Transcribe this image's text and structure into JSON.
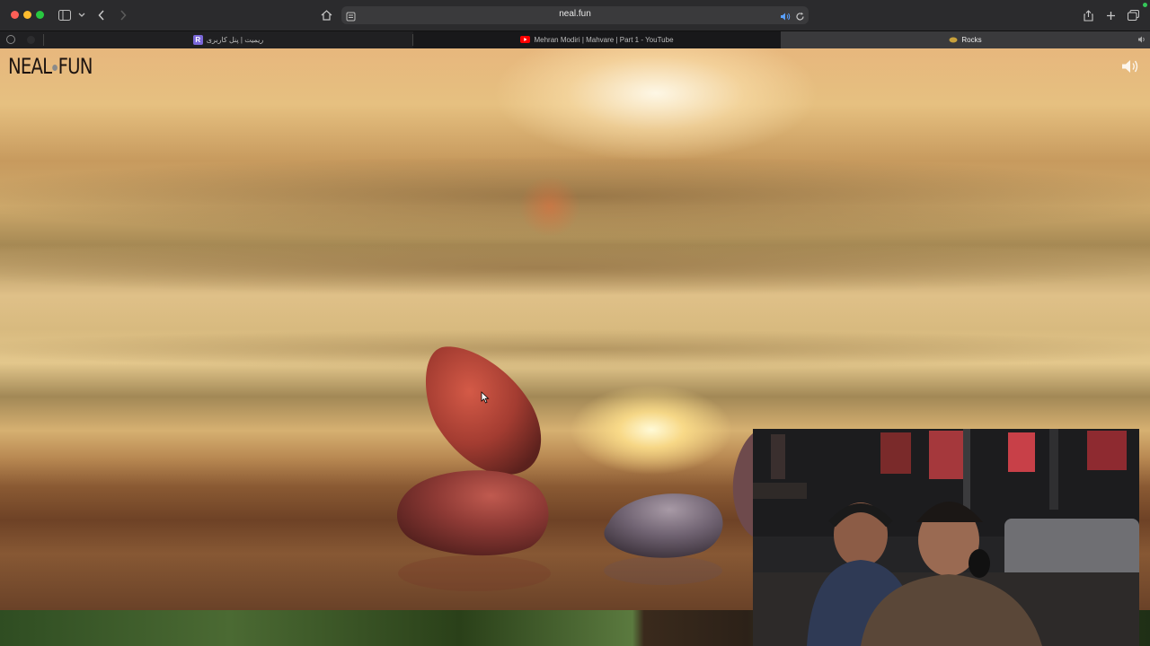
{
  "browser": {
    "address": "neal.fun",
    "tabs": [
      {
        "label": "ریمیت | پنل کاربری",
        "favicon": "R"
      },
      {
        "label": "Mehran Modiri | Mahvare | Part 1 - YouTube"
      },
      {
        "label": "Rocks",
        "active": true
      }
    ]
  },
  "page": {
    "logo_left": "NEAL",
    "logo_right": "FUN"
  },
  "colors": {
    "toolbar": "#2b2b2d",
    "tabbar": "#202022",
    "rock_top": "#b8473a",
    "rock_bottom": "#8d3b36",
    "rock_grey": "#7a6f7c"
  },
  "icons": [
    "sidebar-icon",
    "chevron-down-icon",
    "back-icon",
    "forward-icon",
    "home-icon",
    "reader-icon",
    "audio-icon",
    "reload-icon",
    "share-icon",
    "new-tab-icon",
    "tab-overview-icon",
    "speaker-icon",
    "cursor-icon"
  ]
}
